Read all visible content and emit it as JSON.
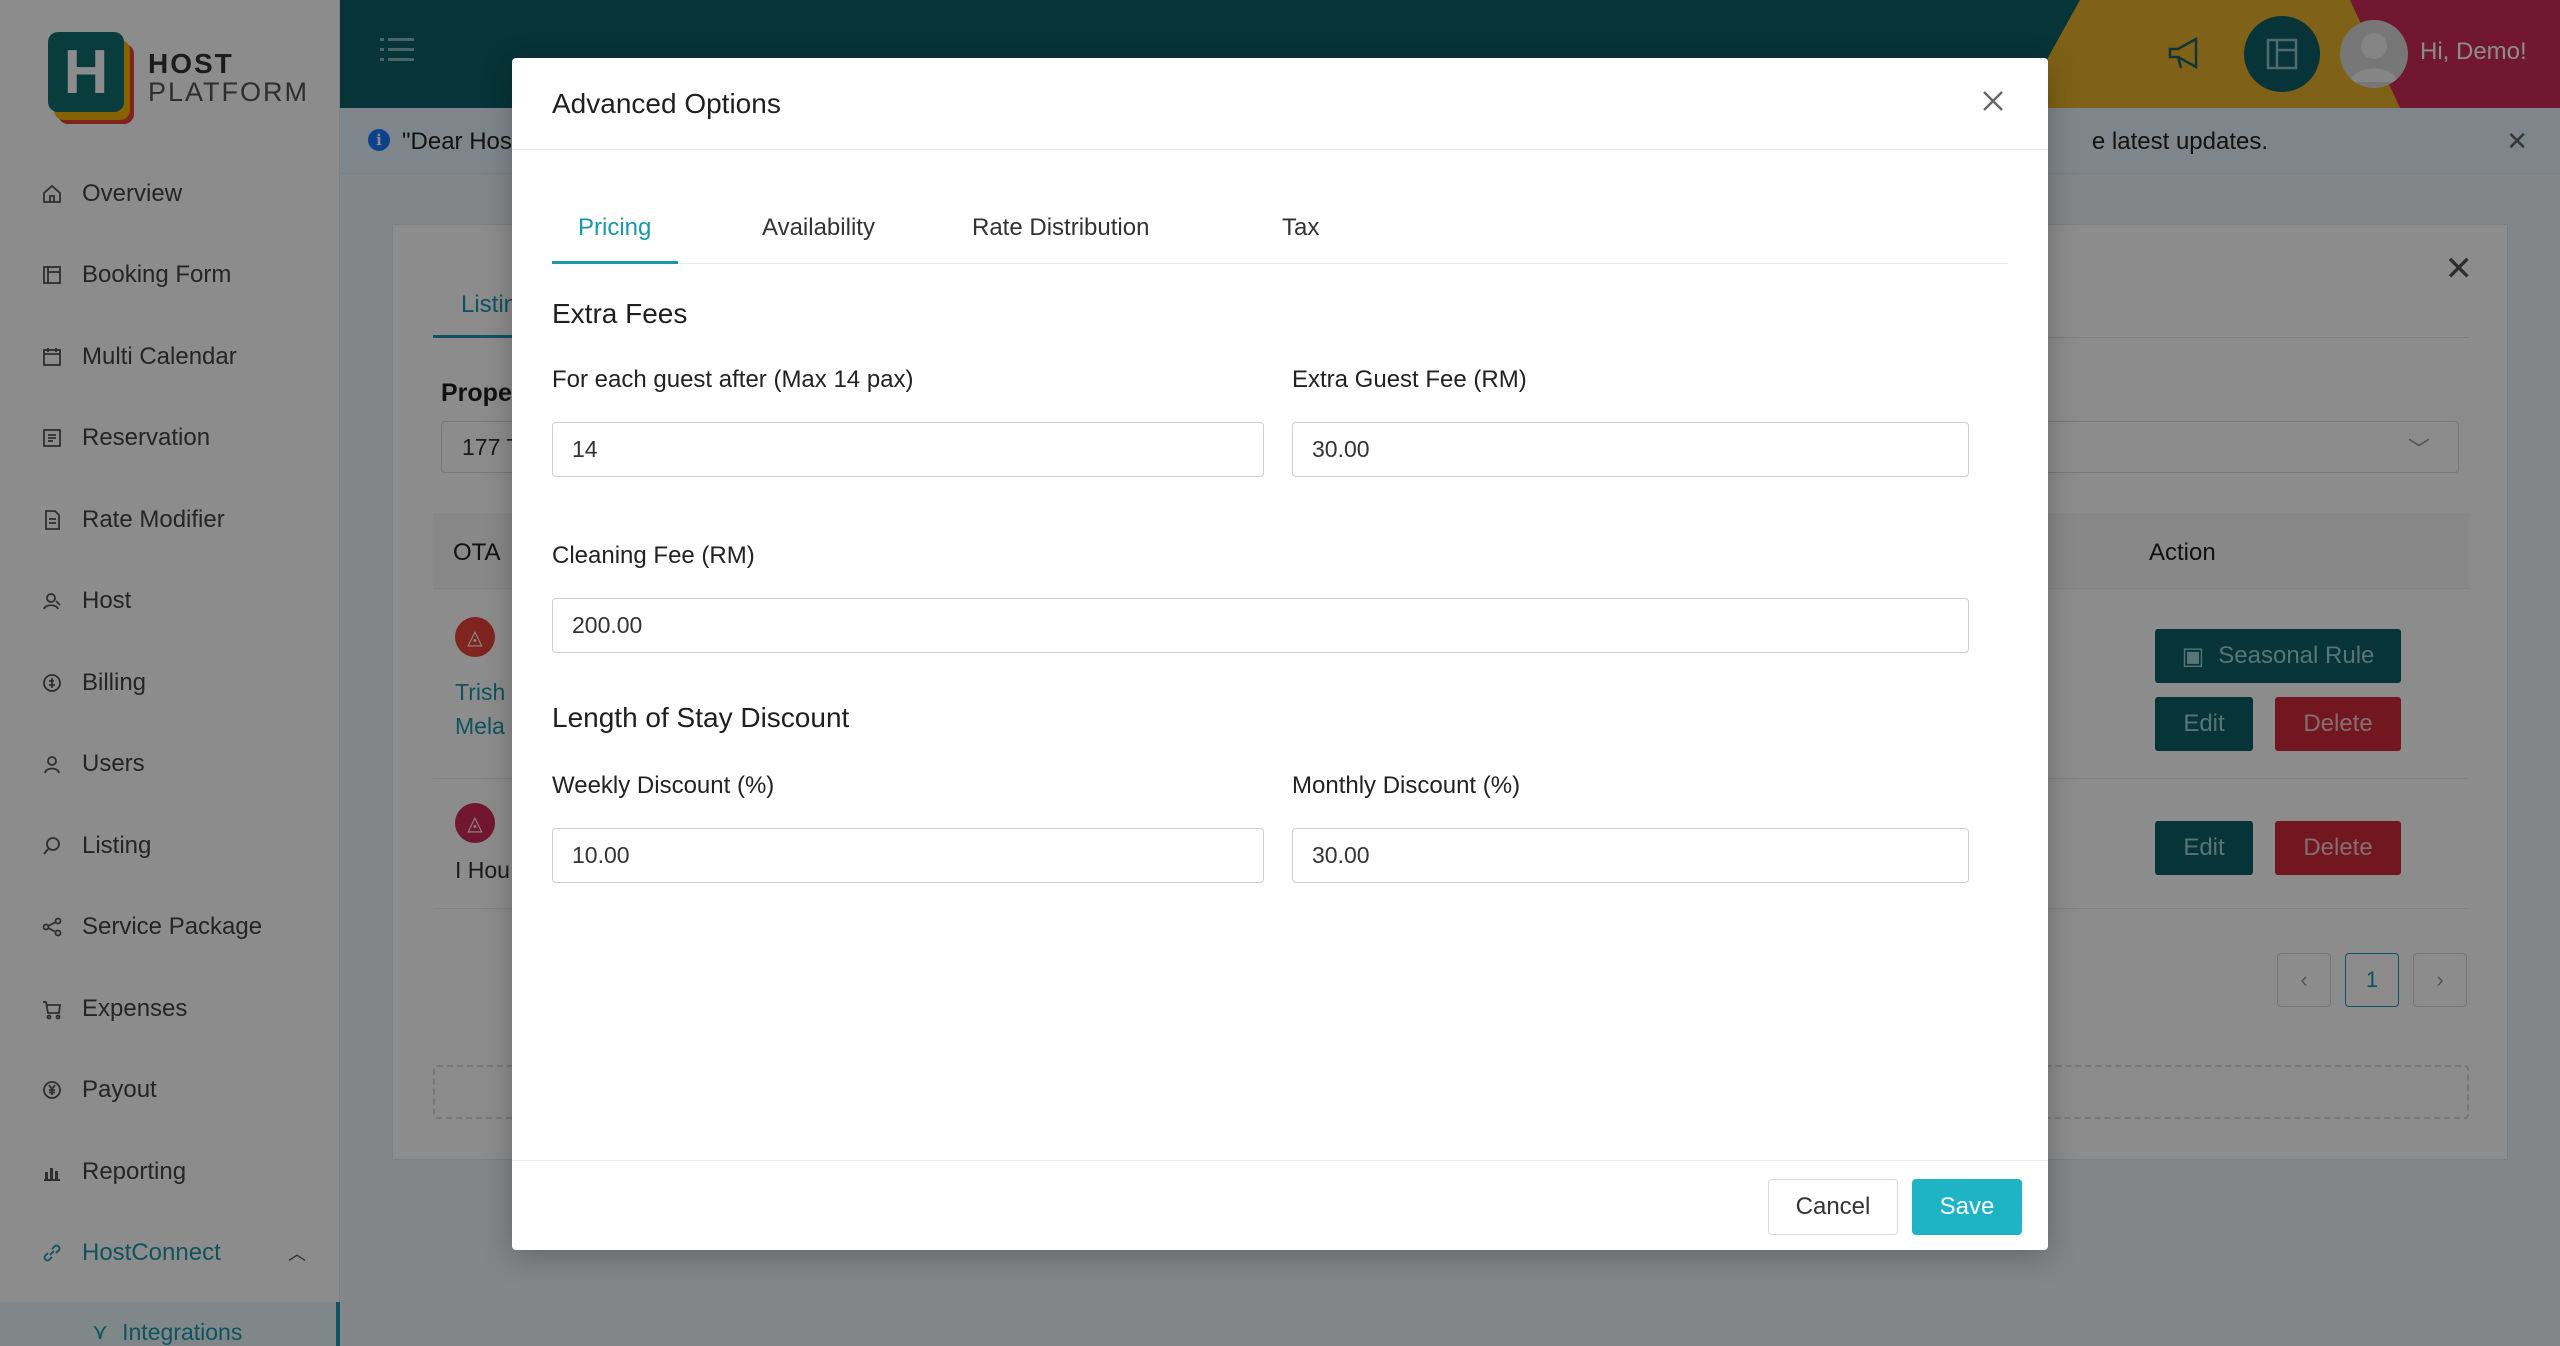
{
  "brand": {
    "line1": "HOST",
    "line2": "PLATFORM",
    "mark": "H"
  },
  "colors": {
    "primary": "#1b97ad",
    "dark_teal": "#0e5f66",
    "yellow": "#e8b22a",
    "magenta": "#cf2b5a",
    "danger": "#cf2b3a",
    "save": "#1fb3c6"
  },
  "sidebar": {
    "items": [
      {
        "label": "Overview",
        "icon": "home-icon"
      },
      {
        "label": "Booking Form",
        "icon": "form-icon"
      },
      {
        "label": "Multi Calendar",
        "icon": "calendar-icon"
      },
      {
        "label": "Reservation",
        "icon": "list-icon"
      },
      {
        "label": "Rate Modifier",
        "icon": "document-icon"
      },
      {
        "label": "Host",
        "icon": "host-icon"
      },
      {
        "label": "Billing",
        "icon": "billing-icon"
      },
      {
        "label": "Users",
        "icon": "user-icon"
      },
      {
        "label": "Listing",
        "icon": "search-icon"
      },
      {
        "label": "Service Package",
        "icon": "share-icon"
      },
      {
        "label": "Expenses",
        "icon": "cart-icon"
      },
      {
        "label": "Payout",
        "icon": "yen-icon"
      },
      {
        "label": "Reporting",
        "icon": "chart-icon"
      },
      {
        "label": "HostConnect",
        "icon": "link-icon"
      }
    ],
    "sub_item": "Integrations"
  },
  "header": {
    "greeting": "Hi, Demo!"
  },
  "notice": {
    "text": "\"Dear Hos",
    "text_end": "e latest updates."
  },
  "background_card": {
    "tab": "Listin",
    "property_label": "Prope",
    "property_value": "177 T",
    "col_ota": "OTA",
    "col_action": "Action",
    "row1_line1": "Trish",
    "row1_line2": "Mela",
    "row2_text": "I Hou",
    "seasonal_rule": "Seasonal Rule",
    "edit": "Edit",
    "delete": "Delete",
    "page": "1"
  },
  "modal": {
    "title": "Advanced Options",
    "tabs": [
      "Pricing",
      "Availability",
      "Rate Distribution",
      "Tax"
    ],
    "active_tab": "Pricing",
    "extra_fees": {
      "title": "Extra Fees",
      "guest_after_label": "For each guest after (Max 14 pax)",
      "guest_after_value": "14",
      "extra_guest_fee_label": "Extra Guest Fee (RM)",
      "extra_guest_fee_value": "30.00",
      "cleaning_fee_label": "Cleaning Fee (RM)",
      "cleaning_fee_value": "200.00"
    },
    "stay_discount": {
      "title": "Length of Stay Discount",
      "weekly_label": "Weekly Discount (%)",
      "weekly_value": "10.00",
      "monthly_label": "Monthly Discount (%)",
      "monthly_value": "30.00"
    },
    "cancel": "Cancel",
    "save": "Save"
  }
}
